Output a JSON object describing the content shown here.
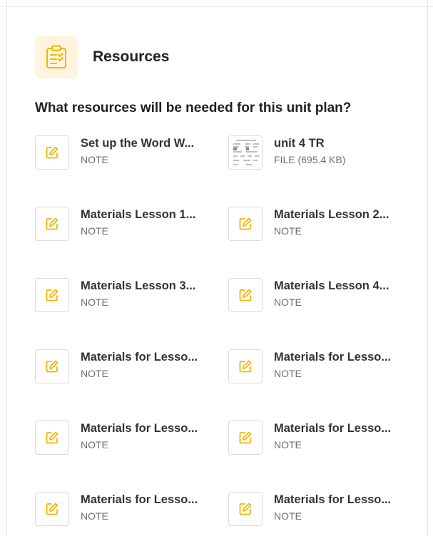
{
  "section": {
    "title": "Resources",
    "icon": "clipboard-checklist-icon",
    "accent_color": "#f5b400",
    "icon_bg": "#fff5de"
  },
  "question": "What resources will be needed for this unit plan?",
  "resources": [
    {
      "title": "Set up the Word W...",
      "type": "NOTE",
      "icon": "edit-note-icon"
    },
    {
      "title": "unit 4 TR",
      "type": "FILE (695.4 KB)",
      "icon": "file-thumbnail"
    },
    {
      "title": "Materials Lesson 1...",
      "type": "NOTE",
      "icon": "edit-note-icon"
    },
    {
      "title": "Materials Lesson 2...",
      "type": "NOTE",
      "icon": "edit-note-icon"
    },
    {
      "title": "Materials Lesson 3...",
      "type": "NOTE",
      "icon": "edit-note-icon"
    },
    {
      "title": "Materials Lesson 4...",
      "type": "NOTE",
      "icon": "edit-note-icon"
    },
    {
      "title": "Materials for Lesso...",
      "type": "NOTE",
      "icon": "edit-note-icon"
    },
    {
      "title": "Materials for Lesso...",
      "type": "NOTE",
      "icon": "edit-note-icon"
    },
    {
      "title": "Materials for Lesso...",
      "type": "NOTE",
      "icon": "edit-note-icon"
    },
    {
      "title": "Materials for Lesso...",
      "type": "NOTE",
      "icon": "edit-note-icon"
    },
    {
      "title": "Materials for Lesso...",
      "type": "NOTE",
      "icon": "edit-note-icon"
    },
    {
      "title": "Materials for Lesso...",
      "type": "NOTE",
      "icon": "edit-note-icon"
    }
  ]
}
